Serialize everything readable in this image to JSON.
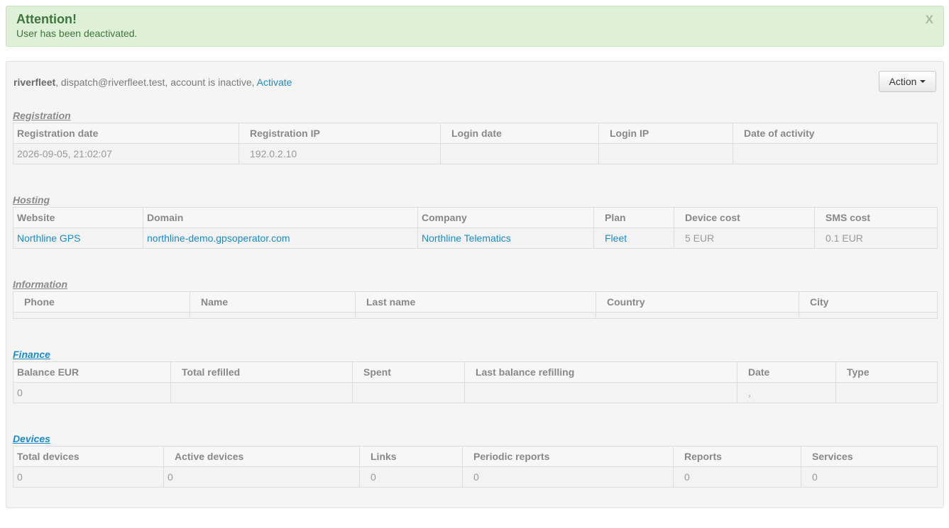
{
  "alert": {
    "title": "Attention!",
    "message": "User has been deactivated.",
    "close_label": "X"
  },
  "summary": {
    "username": "riverfleet",
    "details": ", dispatch@riverfleet.test, account is inactive, ",
    "activate_link": "Activate"
  },
  "action_button": {
    "label": "Action"
  },
  "registration": {
    "title": "Registration",
    "headers": [
      "Registration date",
      "Registration IP",
      "Login date",
      "Login IP",
      "Date of activity"
    ],
    "row": [
      "2026-09-05, 21:02:07",
      "192.0.2.10",
      "",
      "",
      ""
    ]
  },
  "hosting": {
    "title": "Hosting",
    "headers": [
      "Website",
      "Domain",
      "Company",
      "Plan",
      "Device cost",
      "SMS cost"
    ],
    "row": [
      "Northline GPS",
      "northline-demo.gpsoperator.com",
      "Northline Telematics",
      "Fleet",
      "5 EUR",
      "0.1 EUR"
    ]
  },
  "information": {
    "title": "Information",
    "headers": [
      "Phone",
      "Name",
      "Last name",
      "Country",
      "City"
    ]
  },
  "finance": {
    "title": "Finance",
    "headers": [
      "Balance EUR",
      "Total refilled",
      "Spent",
      "Last balance refilling",
      "Date",
      "Type"
    ],
    "row": [
      "0",
      "",
      "",
      "",
      ",",
      ""
    ]
  },
  "devices": {
    "title": "Devices",
    "headers": [
      "Total devices",
      "Active devices",
      "Links",
      "Periodic reports",
      "Reports",
      "Services"
    ],
    "row": [
      "0",
      "0",
      "0",
      "0",
      "0",
      "0"
    ]
  },
  "colors": {
    "alert_bg": "#dff0d8",
    "alert_text": "#3c763d",
    "link": "#1a8bc9",
    "panel_bg": "#f5f5f5"
  }
}
